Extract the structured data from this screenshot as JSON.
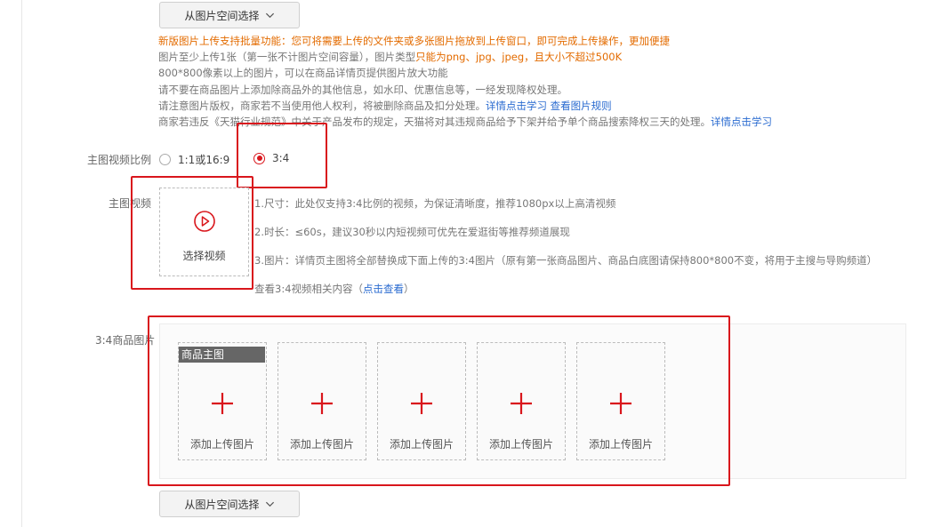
{
  "top_button": {
    "label": "从图片空间选择"
  },
  "notes": {
    "line1": "新版图片上传支持批量功能：您可将需要上传的文件夹或多张图片拖放到上传窗口，即可完成上传操作，更加便捷",
    "line2_a": "图片至少上传1张（第一张不计图片空间容量），图片类型",
    "line2_b": "只能为png、jpg、jpeg，且大小不超过500K",
    "line3": "800*800像素以上的图片，可以在商品详情页提供图片放大功能",
    "line4": "请不要在商品图片上添加除商品外的其他信息，如水印、优惠信息等，一经发现降权处理。",
    "line5_a": "请注意图片版权，商家若不当使用他人权利，将被删除商品及扣分处理。",
    "line5_link1": "详情点击学习",
    "line5_link2": "查看图片规则",
    "line6_a": "商家若违反《天猫行业规范》中关于产品发布的规定，天猫将对其违规商品给予下架并给予单个商品搜索降权三天的处理。",
    "line6_link": "详情点击学习"
  },
  "ratio": {
    "label": "主图视频比例",
    "options": [
      {
        "label": "1:1或16:9",
        "checked": false
      },
      {
        "label": "3:4",
        "checked": true
      }
    ]
  },
  "video": {
    "label": "主图视频",
    "button_label": "选择视频",
    "info1": "1.尺寸：此处仅支持3:4比例的视频，为保证清晰度，推荐1080px以上高清视频",
    "info2": "2.时长：≤60s，建议30秒以内短视频可优先在爱逛街等推荐频道展现",
    "info3": "3.图片：详情页主图将全部替换成下面上传的3:4图片（原有第一张商品图片、商品白底图请保持800*800不变，将用于主搜与导购频道）",
    "info4_a": "查看3:4视频相关内容（",
    "info4_link": "点击查看",
    "info4_b": "）"
  },
  "images": {
    "label": "3:4商品图片",
    "main_tag": "商品主图",
    "slot_label": "添加上传图片",
    "slots": [
      "添加上传图片",
      "添加上传图片",
      "添加上传图片",
      "添加上传图片",
      "添加上传图片"
    ]
  },
  "bottom_button": {
    "label": "从图片空间选择"
  },
  "colors": {
    "accent": "#d9161c",
    "warning": "#e36b00",
    "link": "#2a6bd0"
  }
}
